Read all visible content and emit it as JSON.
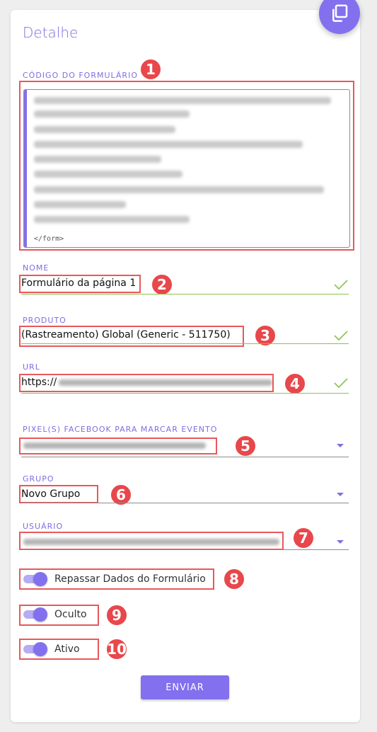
{
  "page": {
    "title": "Detalhe"
  },
  "icons": {
    "fab": "copy-icon",
    "valid": "check-icon",
    "dropdown": "caret-down-icon"
  },
  "colors": {
    "accent": "#8270ee",
    "valid": "#8bc34a",
    "annotation": "#e8474b"
  },
  "form": {
    "code": {
      "label": "CÓDIGO DO FORMULÁRIO",
      "tail": "</form>"
    },
    "name": {
      "label": "NOME",
      "value": "Formulário da página 1"
    },
    "product": {
      "label": "PRODUTO",
      "value": "(Rastreamento) Global (Generic - 511750)"
    },
    "url": {
      "label": "URL",
      "value_prefix": "https://"
    },
    "pixels": {
      "label": "PIXEL(S) FACEBOOK PARA MARCAR EVENTO"
    },
    "group": {
      "label": "GRUPO",
      "value": "Novo Grupo"
    },
    "user": {
      "label": "USUÁRIO"
    },
    "toggles": [
      {
        "label": "Repassar Dados do Formulário",
        "on": true
      },
      {
        "label": "Oculto",
        "on": true
      },
      {
        "label": "Ativo",
        "on": true
      }
    ],
    "submit_label": "ENVIAR"
  },
  "annotations": [
    "1",
    "2",
    "3",
    "4",
    "5",
    "6",
    "7",
    "8",
    "9",
    "10"
  ]
}
